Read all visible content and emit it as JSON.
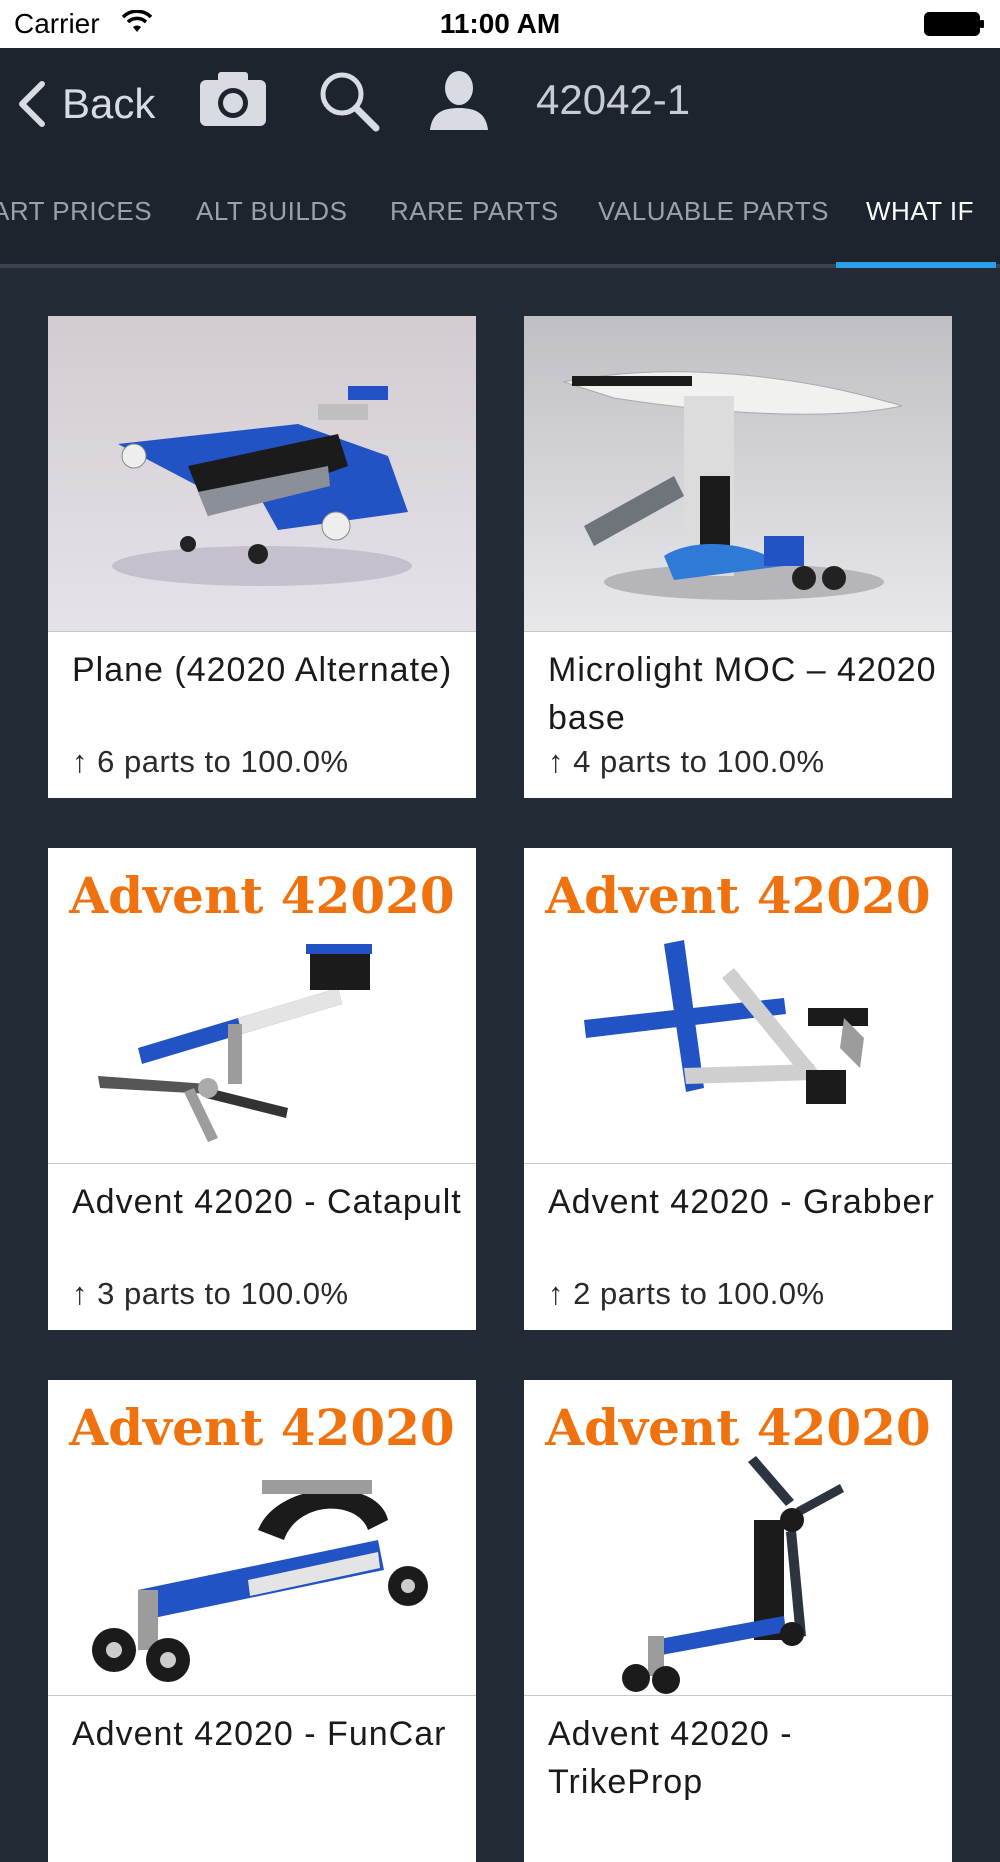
{
  "status_bar": {
    "carrier": "Carrier",
    "time": "11:00 AM"
  },
  "nav": {
    "back_label": "Back",
    "set_number": "42042-1",
    "icons": [
      "camera-icon",
      "search-icon",
      "user-icon"
    ]
  },
  "tabs": [
    {
      "label": "ART PRICES",
      "active": false
    },
    {
      "label": "ALT BUILDS",
      "active": false
    },
    {
      "label": "RARE PARTS",
      "active": false
    },
    {
      "label": "VALUABLE PARTS",
      "active": false
    },
    {
      "label": "WHAT IF",
      "active": true
    }
  ],
  "cards": [
    {
      "title": "Plane (42020 Alternate)",
      "parts": "6 parts to 100.0%",
      "banner": ""
    },
    {
      "title": "Microlight MOC – 42020 base",
      "parts": "4 parts to 100.0%",
      "banner": ""
    },
    {
      "title": "Advent 42020 - Catapult",
      "parts": "3 parts to 100.0%",
      "banner": "Advent 42020"
    },
    {
      "title": "Advent 42020 - Grabber",
      "parts": "2 parts to 100.0%",
      "banner": "Advent 42020"
    },
    {
      "title": "Advent 42020 - FunCar",
      "parts": "",
      "banner": "Advent 42020"
    },
    {
      "title": "Advent 42020 - TrikeProp",
      "parts": "",
      "banner": "Advent 42020"
    }
  ],
  "colors": {
    "background": "#232b37",
    "nav": "#1e242e",
    "accent": "#2aa0e8",
    "banner": "#f0720f"
  }
}
